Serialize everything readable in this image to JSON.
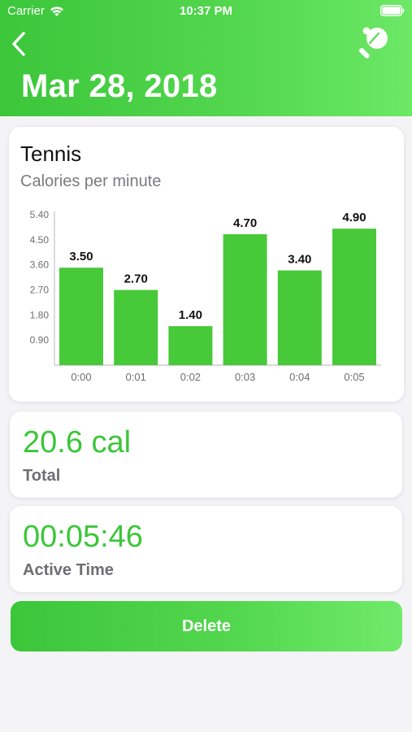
{
  "status_bar": {
    "carrier": "Carrier",
    "time": "10:37 PM"
  },
  "header": {
    "date": "Mar 28, 2018",
    "back_icon": "chevron-left-icon",
    "activity_icon": "ping-pong-paddle-icon"
  },
  "chart_data": {
    "type": "bar",
    "title": "Tennis",
    "subtitle": "Calories per minute",
    "categories": [
      "0:00",
      "0:01",
      "0:02",
      "0:03",
      "0:04",
      "0:05"
    ],
    "values": [
      3.5,
      2.7,
      1.4,
      4.7,
      3.4,
      4.9
    ],
    "value_labels": [
      "3.50",
      "2.70",
      "1.40",
      "4.70",
      "3.40",
      "4.90"
    ],
    "y_ticks": [
      "5.40",
      "4.50",
      "3.60",
      "2.70",
      "1.80",
      "0.90"
    ],
    "ylim": [
      0,
      5.4
    ],
    "grid": false,
    "bar_color": "#48c93a"
  },
  "total": {
    "value": "20.6 cal",
    "label": "Total"
  },
  "active_time": {
    "value": "00:05:46",
    "label": "Active Time"
  },
  "delete_button": {
    "label": "Delete"
  },
  "colors": {
    "accent": "#3cc63a",
    "accent_light": "#6ce866",
    "background": "#f4f4f6"
  }
}
